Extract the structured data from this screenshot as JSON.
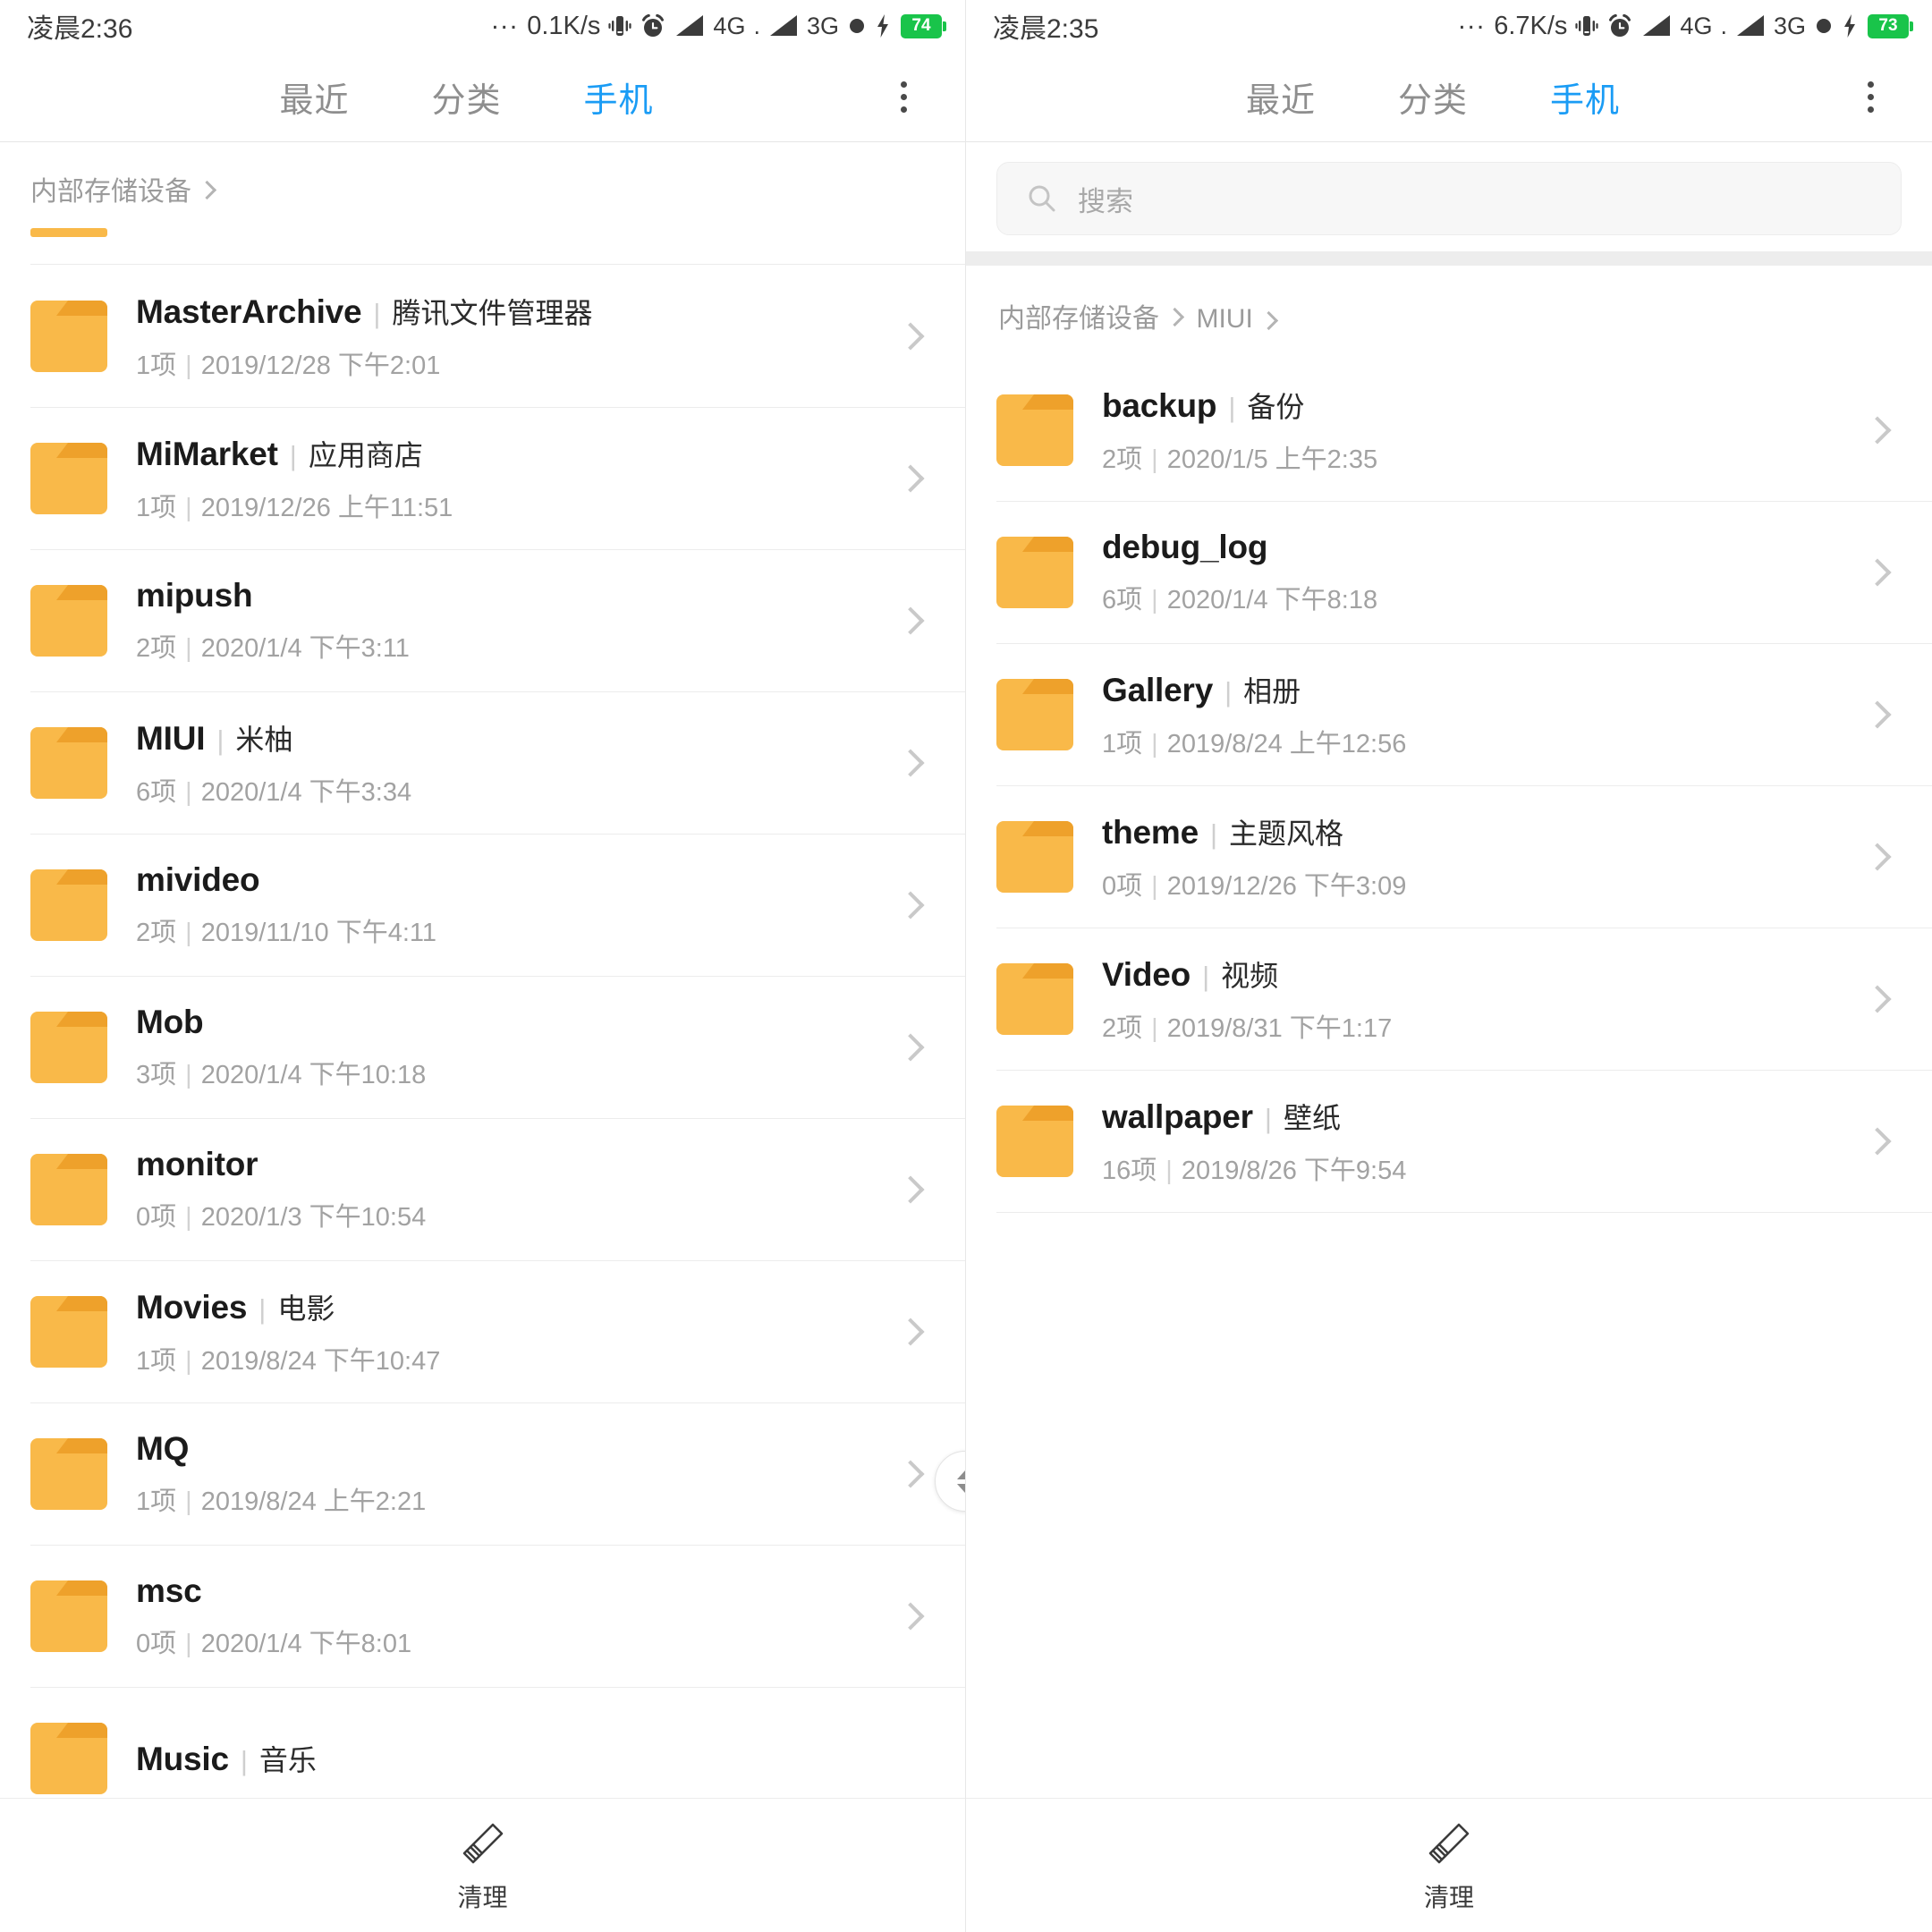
{
  "left": {
    "status": {
      "time": "凌晨2:36",
      "dots": "...",
      "speed": "0.1K/s",
      "vibrate_icon": "vibrate-icon",
      "alarm_icon": "alarm-icon",
      "signal1": "4G",
      "signal1_dot": ".",
      "signal2": "3G",
      "dnd_icon": "dnd-icon",
      "charging_icon": "charging-bolt-icon",
      "battery": "74"
    },
    "tabs": [
      {
        "label": "最近",
        "active": false
      },
      {
        "label": "分类",
        "active": false
      },
      {
        "label": "手机",
        "active": true
      }
    ],
    "overflow_label": "更多",
    "breadcrumb": [
      "内部存储设备"
    ],
    "items": [
      {
        "name": "MasterArchive",
        "alias": "腾讯文件管理器",
        "count": "1项",
        "date": "2019/12/28 下午2:01"
      },
      {
        "name": "MiMarket",
        "alias": "应用商店",
        "count": "1项",
        "date": "2019/12/26 上午11:51"
      },
      {
        "name": "mipush",
        "alias": "",
        "count": "2项",
        "date": "2020/1/4 下午3:11"
      },
      {
        "name": "MIUI",
        "alias": "米柚",
        "count": "6项",
        "date": "2020/1/4 下午3:34"
      },
      {
        "name": "mivideo",
        "alias": "",
        "count": "2项",
        "date": "2019/11/10 下午4:11"
      },
      {
        "name": "Mob",
        "alias": "",
        "count": "3项",
        "date": "2020/1/4 下午10:18"
      },
      {
        "name": "monitor",
        "alias": "",
        "count": "0项",
        "date": "2020/1/3 下午10:54"
      },
      {
        "name": "Movies",
        "alias": "电影",
        "count": "1项",
        "date": "2019/8/24 下午10:47"
      },
      {
        "name": "MQ",
        "alias": "",
        "count": "1项",
        "date": "2019/8/24 上午2:21"
      },
      {
        "name": "msc",
        "alias": "",
        "count": "0项",
        "date": "2020/1/4 下午8:01"
      },
      {
        "name": "Music",
        "alias": "音乐",
        "count": "",
        "date": ""
      }
    ],
    "bottom": {
      "label": "清理",
      "icon": "broom-icon"
    }
  },
  "right": {
    "status": {
      "time": "凌晨2:35",
      "dots": "...",
      "speed": "6.7K/s",
      "vibrate_icon": "vibrate-icon",
      "alarm_icon": "alarm-icon",
      "signal1": "4G",
      "signal1_dot": ".",
      "signal2": "3G",
      "dnd_icon": "dnd-icon",
      "charging_icon": "charging-bolt-icon",
      "battery": "73"
    },
    "tabs": [
      {
        "label": "最近",
        "active": false
      },
      {
        "label": "分类",
        "active": false
      },
      {
        "label": "手机",
        "active": true
      }
    ],
    "overflow_label": "更多",
    "search": {
      "placeholder": "搜索",
      "icon": "search-icon",
      "value": ""
    },
    "breadcrumb": [
      "内部存储设备",
      "MIUI"
    ],
    "items": [
      {
        "name": "backup",
        "alias": "备份",
        "count": "2项",
        "date": "2020/1/5 上午2:35"
      },
      {
        "name": "debug_log",
        "alias": "",
        "count": "6项",
        "date": "2020/1/4 下午8:18"
      },
      {
        "name": "Gallery",
        "alias": "相册",
        "count": "1项",
        "date": "2019/8/24 上午12:56"
      },
      {
        "name": "theme",
        "alias": "主题风格",
        "count": "0项",
        "date": "2019/12/26 下午3:09"
      },
      {
        "name": "Video",
        "alias": "视频",
        "count": "2项",
        "date": "2019/8/31 下午1:17"
      },
      {
        "name": "wallpaper",
        "alias": "壁纸",
        "count": "16项",
        "date": "2019/8/26 下午9:54"
      }
    ],
    "bottom": {
      "label": "清理",
      "icon": "broom-icon"
    }
  },
  "colors": {
    "accent": "#1a9cf5",
    "folder": "#f9b949",
    "folder_tab": "#eea12b",
    "battery": "#19c44a"
  }
}
